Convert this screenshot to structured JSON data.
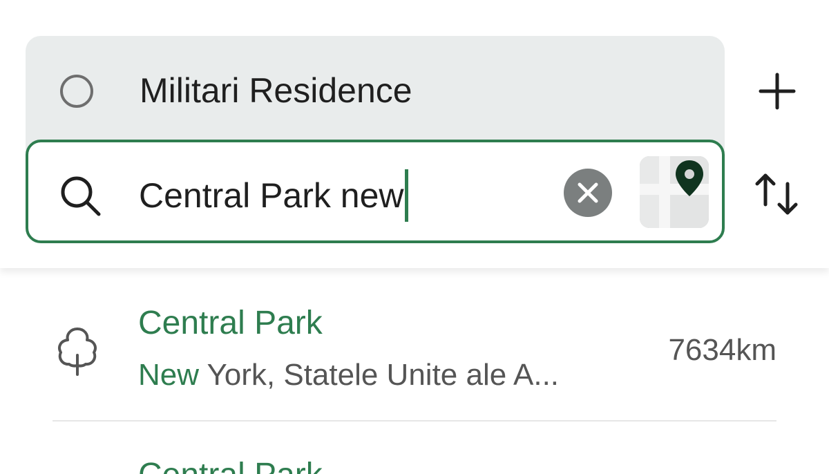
{
  "route": {
    "origin": {
      "label": "Militari Residence",
      "icon": "circle-icon"
    },
    "destination": {
      "value": "Central Park new",
      "icon": "search-icon"
    },
    "clear_icon": "clear-icon",
    "map_picker_icon": "map-pin-icon",
    "add_stop_icon": "plus-icon",
    "swap_icon": "swap-icon"
  },
  "results": [
    {
      "title": "Central Park",
      "subtitle_match": "New",
      "subtitle_rest": " York, Statele Unite ale A...",
      "distance": "7634km",
      "icon": "tree-icon"
    },
    {
      "title": "Central Park"
    }
  ],
  "colors": {
    "accent": "#2e7d4f",
    "route_box_bg": "#e9ecec",
    "secondary_text": "#555555"
  }
}
